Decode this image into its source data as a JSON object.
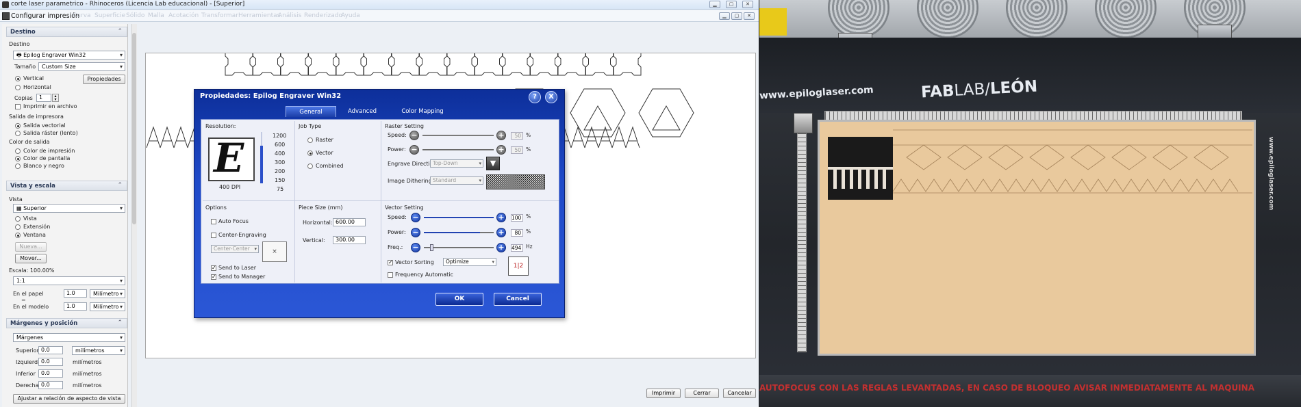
{
  "window": {
    "title": "corte laser parametrico - Rhinoceros (Licencia Lab educacional) - [Superior]",
    "print_dialog_title": "Configurar impresión",
    "menu_hints": [
      "Curva",
      "Superficie",
      "Sólido",
      "Malla",
      "Acotación",
      "Transformar",
      "Herramientas",
      "Análisis",
      "Renderizado",
      "Ayuda"
    ]
  },
  "left_panel": {
    "destino": {
      "header": "Destino",
      "label": "Destino",
      "printer": "Epilog Engraver Win32",
      "size_label": "Tamaño",
      "size_value": "Custom Size",
      "orientation": [
        {
          "label": "Vertical",
          "selected": true
        },
        {
          "label": "Horizontal",
          "selected": false
        }
      ],
      "properties_button": "Propiedades",
      "copies_label": "Copias",
      "copies_value": "1",
      "print_to_file": "Imprimir en archivo",
      "output_label": "Salida de impresora",
      "output_options": [
        {
          "label": "Salida vectorial",
          "selected": true
        },
        {
          "label": "Salida ráster (lento)",
          "selected": false
        }
      ],
      "color_label": "Color de salida",
      "color_options": [
        {
          "label": "Color de impresión",
          "selected": false
        },
        {
          "label": "Color de pantalla",
          "selected": true
        },
        {
          "label": "Blanco y negro",
          "selected": false
        }
      ]
    },
    "vista": {
      "header": "Vista y escala",
      "label": "Vista",
      "view_value": "Superior",
      "view_options": [
        {
          "label": "Vista",
          "selected": false
        },
        {
          "label": "Extensión",
          "selected": false
        },
        {
          "label": "Ventana",
          "selected": true
        }
      ],
      "new_button": "Nueva...",
      "move_button": "Mover...",
      "scale_label": "Escala: 100.00%",
      "scale_value": "1:1",
      "paper_label": "En el papel",
      "paper_value": "1.0",
      "paper_unit": "Milímetro",
      "model_label": "En el modelo",
      "model_value": "1.0",
      "model_unit": "Milímetro"
    },
    "margenes": {
      "header": "Márgenes y posición",
      "margins_value": "Márgenes",
      "rows": [
        {
          "label": "Superior",
          "value": "0.0",
          "unit": "milímetros"
        },
        {
          "label": "Izquierda",
          "value": "0.0",
          "unit": "milímetros"
        },
        {
          "label": "Inferior",
          "value": "0.0",
          "unit": "milímetros"
        },
        {
          "label": "Derecha",
          "value": "0.0",
          "unit": "milímetros"
        }
      ],
      "fit_button": "Ajustar a relación de aspecto de vista"
    }
  },
  "bottom_buttons": {
    "print": "Imprimir",
    "close": "Cerrar",
    "cancel": "Cancelar"
  },
  "dialog": {
    "title": "Propiedades: Epilog Engraver Win32",
    "help": "?",
    "close": "X",
    "tabs": [
      {
        "label": "General",
        "active": true
      },
      {
        "label": "Advanced",
        "active": false
      },
      {
        "label": "Color Mapping",
        "active": false
      }
    ],
    "resolution": {
      "label": "Resolution:",
      "dpi_text": "400 DPI",
      "levels": [
        "1200",
        "600",
        "400",
        "300",
        "200",
        "150",
        "75"
      ],
      "letter": "E"
    },
    "job_type": {
      "label": "Job Type",
      "options": [
        {
          "label": "Raster",
          "selected": false
        },
        {
          "label": "Vector",
          "selected": true
        },
        {
          "label": "Combined",
          "selected": false
        }
      ]
    },
    "raster": {
      "label": "Raster Setting",
      "speed_label": "Speed:",
      "speed_value": "50",
      "speed_unit": "%",
      "power_label": "Power:",
      "power_value": "50",
      "power_unit": "%",
      "direction_label": "Engrave Direction:",
      "direction_value": "Top-Down",
      "dithering_label": "Image Dithering:",
      "dithering_value": "Standard"
    },
    "options": {
      "label": "Options",
      "auto_focus": "Auto Focus",
      "center_engraving": "Center-Engraving",
      "center_value": "Center-Center",
      "send_to_laser": "Send to Laser",
      "send_to_manager": "Send to Manager"
    },
    "piece_size": {
      "label": "Piece Size (mm)",
      "horizontal_label": "Horizontal:",
      "horizontal_value": "600.00",
      "vertical_label": "Vertical:",
      "vertical_value": "300.00"
    },
    "vector": {
      "label": "Vector Setting",
      "speed_label": "Speed:",
      "speed_value": "100",
      "speed_unit": "%",
      "power_label": "Power:",
      "power_value": "80",
      "power_unit": "%",
      "freq_label": "Freq.:",
      "freq_value": "494",
      "freq_unit": "Hz",
      "sorting_label": "Vector Sorting",
      "sorting_value": "Optimize",
      "freq_auto_label": "Frequency Automatic"
    },
    "ok": "OK",
    "cancel": "Cancel"
  },
  "photo": {
    "site": "www.epiloglaser.com",
    "brand_left": "FAB",
    "brand_mid": "LAB/",
    "brand_right": "LEÓN",
    "side_text": "www.epiloglaser.com",
    "warning": "AUTOFOCUS CON LAS REGLAS LEVANTADAS, EN CASO DE BLOQUEO AVISAR INMEDIATAMENTE AL MAQUINA"
  }
}
